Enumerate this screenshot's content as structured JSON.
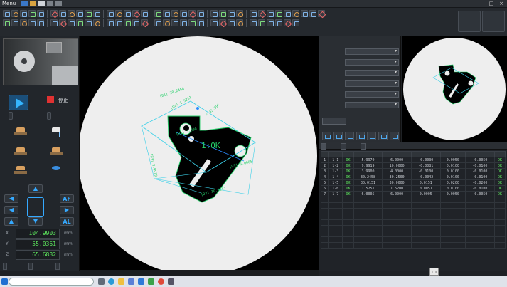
{
  "menubar": {
    "menu": "Menu",
    "title": ""
  },
  "left": {
    "stop": "停止",
    "btn_auto_focus": "",
    "btn_measure": "",
    "jog": {
      "af": "AF",
      "al": "AL"
    },
    "coords": [
      {
        "axis": "X",
        "value": "104.9903",
        "unit": "mm"
      },
      {
        "axis": "Y",
        "value": "55.0361",
        "unit": "mm"
      },
      {
        "axis": "Z",
        "value": "65.6882",
        "unit": "mm"
      }
    ],
    "bottom": [
      "",
      "",
      ""
    ]
  },
  "viewer": {
    "labels": {
      "result": "1:OK",
      "dim_top": "[D1] 30.2458",
      "dim_bottom": "[D2] 30.0151",
      "dim_left": "[D3] 9.9919",
      "dim_angle": "∠ 45.99°",
      "dim_r1": "[R1] 3.990",
      "dim_d4": "[D4] 1.5251",
      "dim_d5": "[D5] 6.0005"
    },
    "status": ""
  },
  "mid": {
    "top_label": "",
    "top_value": "",
    "rows": [
      "",
      "",
      "",
      "",
      "",
      ""
    ],
    "action": ""
  },
  "table": {
    "tabs": [
      "",
      "",
      ""
    ],
    "headers": [
      "",
      "",
      "",
      "",
      "",
      "",
      "",
      "",
      ""
    ],
    "rows": [
      [
        "1",
        "1-1",
        "OK",
        "5.9970",
        "6.0000",
        "-0.0030",
        "0.0050",
        "-0.0050",
        "OK"
      ],
      [
        "2",
        "1-2",
        "OK",
        "9.9919",
        "10.0000",
        "-0.0081",
        "0.0100",
        "-0.0100",
        "OK"
      ],
      [
        "3",
        "1-3",
        "OK",
        "3.9900",
        "4.0000",
        "-0.0100",
        "0.0100",
        "-0.0100",
        "OK"
      ],
      [
        "4",
        "1-4",
        "OK",
        "30.2458",
        "30.2500",
        "-0.0042",
        "0.0100",
        "-0.0100",
        "OK"
      ],
      [
        "5",
        "1-5",
        "OK",
        "30.0151",
        "30.0000",
        "0.0151",
        "0.0200",
        "-0.0200",
        "OK"
      ],
      [
        "6",
        "1-6",
        "OK",
        "1.5251",
        "1.5200",
        "0.0051",
        "0.0100",
        "-0.0100",
        "OK"
      ],
      [
        "7",
        "1-7",
        "OK",
        "6.0005",
        "6.0000",
        "0.0005",
        "0.0050",
        "-0.0050",
        "OK"
      ]
    ]
  },
  "taskbar": {
    "search_placeholder": "",
    "weather": "",
    "time": "",
    "date": "",
    "ime": "中"
  }
}
